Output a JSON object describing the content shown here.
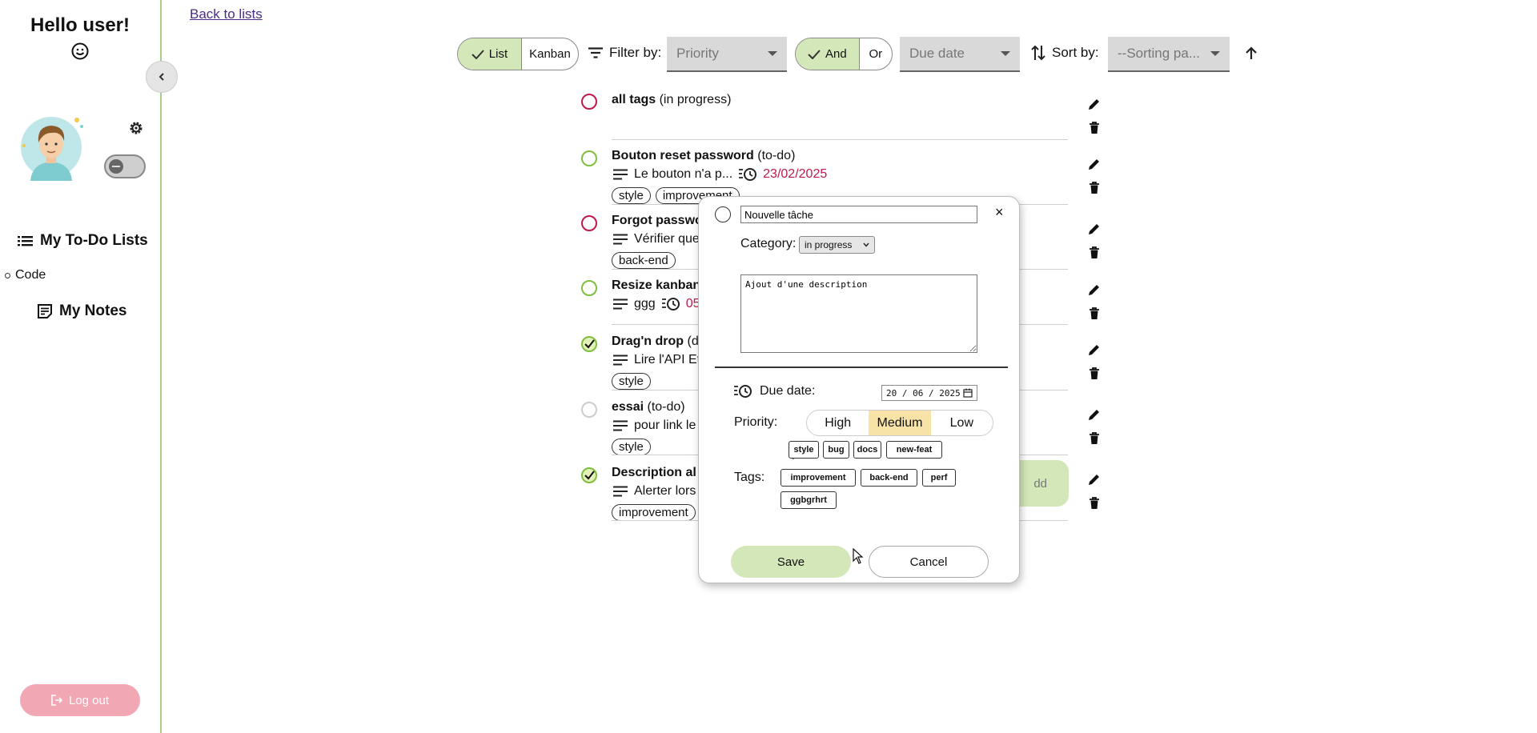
{
  "sidebar": {
    "greeting": "Hello user!",
    "todo_lists_label": "My To-Do Lists",
    "lists": [
      {
        "label": "Code"
      }
    ],
    "notes_label": "My Notes",
    "logout_label": "Log out"
  },
  "header": {
    "back_link": "Back to lists",
    "view_list": "List",
    "view_kanban": "Kanban",
    "filter_label": "Filter by:",
    "priority_placeholder": "Priority",
    "logic_and": "And",
    "logic_or": "Or",
    "due_date_placeholder": "Due date",
    "sort_label": "Sort by:",
    "sort_placeholder": "--Sorting pa..."
  },
  "tasks": [
    {
      "title": "all tags",
      "status": "(in progress)",
      "circle_color": "#c0194a"
    },
    {
      "title": "Bouton reset password",
      "status": "(to-do)",
      "desc": "Le bouton n'a p...",
      "date": "23/02/2025",
      "tags": [
        "style",
        "improvement"
      ],
      "circle_color": "#7fbf3f"
    },
    {
      "title": "Forgot passwo",
      "desc": "Vérifier que",
      "tags": [
        "back-end"
      ],
      "circle_color": "#c0194a"
    },
    {
      "title": "Resize kanban",
      "desc": "ggg",
      "date": "05",
      "circle_color": "#7fbf3f"
    },
    {
      "title": "Drag'n drop",
      "status": "(d",
      "desc": "Lire l'API Et",
      "tags": [
        "style"
      ],
      "circle_color": "#7fbf3f",
      "done": true
    },
    {
      "title": "essai",
      "status": "(to-do)",
      "desc": "pour link le",
      "tags": [
        "style"
      ],
      "circle_color": "#cccccc"
    },
    {
      "title": "Description al",
      "desc": "Alerter lors",
      "tags": [
        "improvement"
      ],
      "circle_color": "#7fbf3f",
      "done": true
    }
  ],
  "add_button_label": "dd",
  "modal": {
    "title_value": "Nouvelle tâche",
    "category_label": "Category:",
    "category_value": "in progress",
    "description_value": "Ajout d'une description",
    "due_date_label": "Due date:",
    "due_date_value": "20 / 06 / 2025",
    "priority_label": "Priority:",
    "priority_options": [
      "High",
      "Medium",
      "Low"
    ],
    "priority_selected": "Medium",
    "tags_label": "Tags:",
    "available_tags": [
      "style",
      "bug",
      "docs",
      "new-feat"
    ],
    "selected_tags": [
      "improvement",
      "back-end",
      "perf",
      "ggbgrhrt"
    ],
    "save_label": "Save",
    "cancel_label": "Cancel",
    "close_symbol": "×"
  },
  "colors": {
    "accent_green": "#d3e7b9",
    "sidebar_border": "#a8d08a",
    "date_red": "#c0194a",
    "logout_pink": "#f2a7b5",
    "priority_selected": "#f7e3a8"
  }
}
